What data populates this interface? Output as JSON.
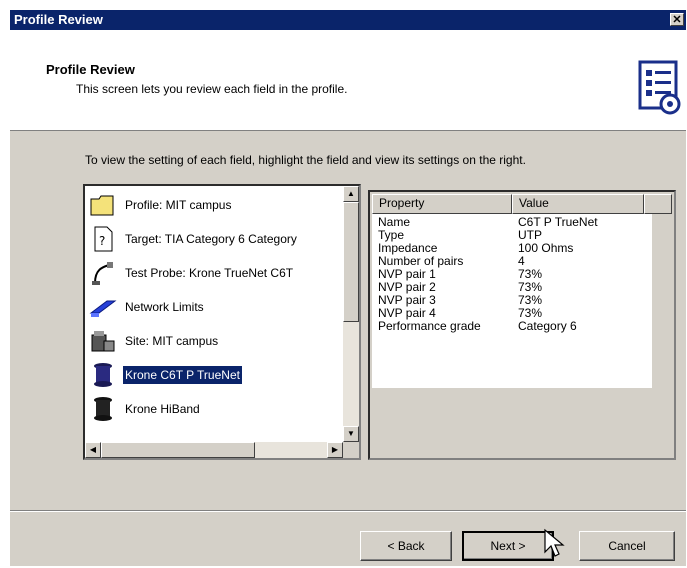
{
  "window": {
    "title": "Profile Review"
  },
  "header": {
    "title": "Profile Review",
    "subtitle": "This screen lets you review each field in the profile."
  },
  "instruction": "To view the setting of each field, highlight the field and view its settings on the right.",
  "tree": {
    "items": [
      {
        "label": "Profile: MIT campus",
        "icon": "folder-icon"
      },
      {
        "label": "Target: TIA Category 6 Category",
        "icon": "document-icon"
      },
      {
        "label": "Test Probe: Krone TrueNet C6T",
        "icon": "probe-icon"
      },
      {
        "label": "Network Limits",
        "icon": "book-icon"
      },
      {
        "label": "Site: MIT campus",
        "icon": "site-icon"
      },
      {
        "label": "Krone C6T P TrueNet",
        "icon": "cable-spool-icon",
        "selected": true
      },
      {
        "label": "Krone HiBand",
        "icon": "cable-spool-icon"
      }
    ]
  },
  "properties": {
    "headers": {
      "property": "Property",
      "value": "Value"
    },
    "rows": [
      {
        "key": "Name",
        "value": "C6T P TrueNet"
      },
      {
        "key": "Type",
        "value": "UTP"
      },
      {
        "key": "Impedance",
        "value": "100 Ohms"
      },
      {
        "key": "Number of pairs",
        "value": "4"
      },
      {
        "key": "NVP pair 1",
        "value": "73%"
      },
      {
        "key": "NVP pair 2",
        "value": "73%"
      },
      {
        "key": "NVP pair 3",
        "value": "73%"
      },
      {
        "key": "NVP pair 4",
        "value": "73%"
      },
      {
        "key": "Performance grade",
        "value": "Category 6"
      }
    ]
  },
  "buttons": {
    "back": "< Back",
    "next": "Next >",
    "cancel": "Cancel"
  }
}
